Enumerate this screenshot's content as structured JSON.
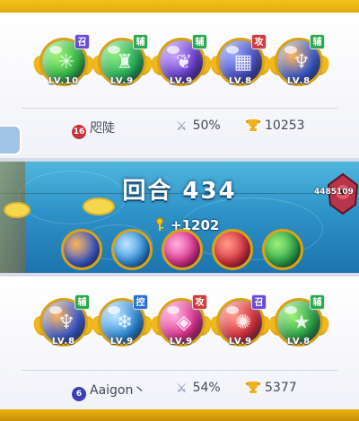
{
  "top_team": {
    "heroes": [
      {
        "role": "召",
        "level": "LV.10",
        "color": "#35c04a",
        "glow": "#a3f07a",
        "badge_color": "#6a4bd8",
        "glyph": "✳"
      },
      {
        "role": "辅",
        "level": "LV.9",
        "color": "#27b75e",
        "glow": "#8de87b",
        "badge_color": "#2ca84e",
        "glyph": "♜"
      },
      {
        "role": "辅",
        "level": "LV.9",
        "color": "#6a3ed0",
        "glow": "#c9a3ff",
        "badge_color": "#2ca84e",
        "glyph": "❦"
      },
      {
        "role": "攻",
        "level": "LV.8",
        "color": "#4a52c9",
        "glow": "#9aa3ff",
        "badge_color": "#d23c3c",
        "glyph": "▦"
      },
      {
        "role": "辅",
        "level": "LV.8",
        "color": "#3d5fd8",
        "glow": "#ffb454",
        "badge_color": "#2ca84e",
        "glyph": "♆"
      }
    ],
    "player": {
      "rank": "16",
      "name": "咫陡",
      "rank_color": "#c8323c"
    },
    "winrate": "50%",
    "trophies": "10253"
  },
  "battle": {
    "round_label": "回合 434",
    "bonus": "+1202",
    "enemy_hp": "4485109"
  },
  "bottom_team": {
    "heroes": [
      {
        "role": "辅",
        "level": "LV.8",
        "color": "#3d5fd8",
        "glow": "#ffb454",
        "badge_color": "#2ca84e",
        "glyph": "♆"
      },
      {
        "role": "控",
        "level": "LV.9",
        "color": "#2f8fe0",
        "glow": "#bfe7ff",
        "badge_color": "#2a6fd6",
        "glyph": "❄"
      },
      {
        "role": "攻",
        "level": "LV.9",
        "color": "#e0308f",
        "glow": "#ffb3e0",
        "badge_color": "#d23c3c",
        "glyph": "◈"
      },
      {
        "role": "召",
        "level": "LV.9",
        "color": "#d83040",
        "glow": "#ff9b8a",
        "badge_color": "#6a4bd8",
        "glyph": "✺"
      },
      {
        "role": "辅",
        "level": "LV.8",
        "color": "#2ea84b",
        "glow": "#9ef07a",
        "badge_color": "#2ca84e",
        "glyph": "★"
      }
    ],
    "player": {
      "rank": "6",
      "name": "Aaigon丶",
      "rank_color": "#3a3fb5"
    },
    "winrate": "54%",
    "trophies": "5377"
  },
  "icons": {
    "swords": "crossed-swords-icon",
    "trophy": "trophy-icon",
    "key": "key-icon"
  }
}
